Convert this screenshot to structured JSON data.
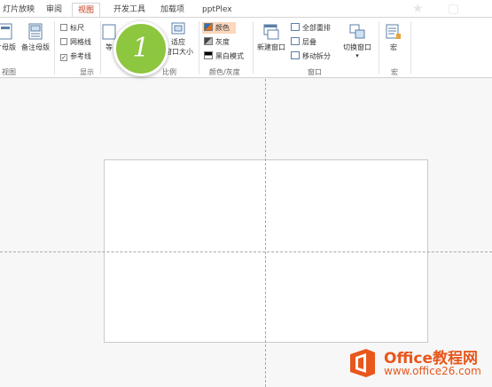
{
  "tabs": [
    {
      "label": "灯片放映"
    },
    {
      "label": "审阅"
    },
    {
      "label": "视图"
    },
    {
      "label": "开发工具"
    },
    {
      "label": "加载项"
    },
    {
      "label": "pptPlex"
    }
  ],
  "active_tab": "视图",
  "ribbon": {
    "views": {
      "btn1": "片母版",
      "btn2": "备注母版",
      "label": "视图"
    },
    "show": {
      "ruler": "标尺",
      "gridlines": "网格线",
      "guides": "参考线",
      "guides_checked": "✓",
      "label": "显示"
    },
    "zoom": {
      "btn_partial": "等",
      "fit_line1": "适应",
      "fit_line2": "窗口大小",
      "label": "显示比例",
      "label_visible": "比例"
    },
    "color": {
      "color": "颜色",
      "grayscale": "灰度",
      "bw": "黑白模式",
      "label": "颜色/灰度"
    },
    "window": {
      "new_window": "新建窗口",
      "arrange_all": "全部重排",
      "cascade": "层叠",
      "move_split": "移动拆分",
      "switch_windows": "切换窗口",
      "dropdown": "▾",
      "label": "窗口"
    },
    "macros": {
      "macro": "宏",
      "label": "宏"
    }
  },
  "badge": {
    "number": "1"
  },
  "watermark": {
    "title": "Office教程网",
    "url": "www.office26.com"
  },
  "colors": {
    "accent": "#c43b1d",
    "badge": "#8dc63f",
    "watermark": "#e8571c",
    "highlight": "#fcd7bb"
  }
}
